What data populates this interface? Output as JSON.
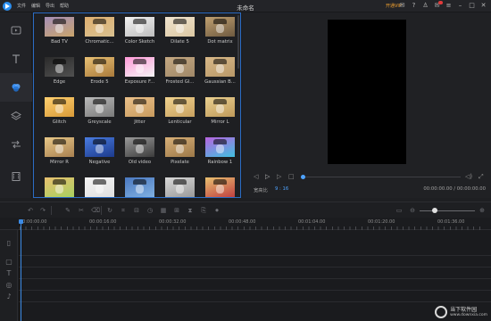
{
  "titlebar": {
    "menu": [
      "文件",
      "编辑",
      "导出",
      "帮助"
    ],
    "title": "未命名",
    "vip_label": "开通VIP"
  },
  "effects": [
    {
      "label": "Bad TV",
      "colors": [
        "#a58fb8",
        "#c9a46c"
      ]
    },
    {
      "label": "Chromatic...",
      "colors": [
        "#e0b070",
        "#d8c090"
      ]
    },
    {
      "label": "Color Sketch",
      "colors": [
        "#f2f2f2",
        "#bdbdbd"
      ]
    },
    {
      "label": "Dilate 5",
      "colors": [
        "#f0e4cf",
        "#dcc8a3"
      ]
    },
    {
      "label": "Dot matrix",
      "colors": [
        "#c0a070",
        "#6e5a40"
      ]
    },
    {
      "label": "Edge",
      "colors": [
        "#2a2a2a",
        "#505050"
      ]
    },
    {
      "label": "Erode 5",
      "colors": [
        "#e8c074",
        "#a97a3b"
      ]
    },
    {
      "label": "Exposure F...",
      "colors": [
        "#ff9ad8",
        "#f4f4f4"
      ]
    },
    {
      "label": "Frosted Gl...",
      "colors": [
        "#c4a882",
        "#a08868"
      ]
    },
    {
      "label": "Gaussian B...",
      "colors": [
        "#d8b888",
        "#b89868"
      ]
    },
    {
      "label": "Glitch",
      "colors": [
        "#ffd070",
        "#d89a38"
      ]
    },
    {
      "label": "Greyscale",
      "colors": [
        "#b9b9b9",
        "#7a7a7a"
      ]
    },
    {
      "label": "Jitter",
      "colors": [
        "#eac08a",
        "#c89b5e"
      ]
    },
    {
      "label": "Lenticular",
      "colors": [
        "#f0d28e",
        "#c8a160"
      ]
    },
    {
      "label": "Mirror L",
      "colors": [
        "#ead090",
        "#bf9a5a"
      ]
    },
    {
      "label": "Mirror R",
      "colors": [
        "#e8c888",
        "#a88050"
      ]
    },
    {
      "label": "Negative",
      "colors": [
        "#4a7ce0",
        "#1c3a8c"
      ]
    },
    {
      "label": "Old video",
      "colors": [
        "#9a9a9a",
        "#3c3c3c"
      ]
    },
    {
      "label": "Pixelate",
      "colors": [
        "#d8b078",
        "#9c7848"
      ]
    },
    {
      "label": "Rainbow 1",
      "colors": [
        "#b864e0",
        "#40c0e0"
      ]
    },
    {
      "label": "",
      "colors": [
        "#e8c070",
        "#a8d060"
      ]
    },
    {
      "label": "",
      "colors": [
        "#f4f4f4",
        "#e0e0e0"
      ]
    },
    {
      "label": "",
      "colors": [
        "#4a78c0",
        "#80b0e0"
      ]
    },
    {
      "label": "",
      "colors": [
        "#d8d8d8",
        "#9a9a9a"
      ]
    },
    {
      "label": "",
      "colors": [
        "#e8c070",
        "#c04040"
      ]
    }
  ],
  "preview": {
    "ratio_label": "宽高比",
    "ratio_value": "9 : 16",
    "timecode": "00:00:00.00 / 00:00:00.00"
  },
  "ruler": [
    "00:00:00.00",
    "00:00:16.00",
    "00:00:32.00",
    "00:00:48.00",
    "00:01:04.00",
    "00:01:20.00",
    "00:01:36.00"
  ],
  "watermark": {
    "brand": "当下软件园",
    "url": "www.downxia.com"
  }
}
